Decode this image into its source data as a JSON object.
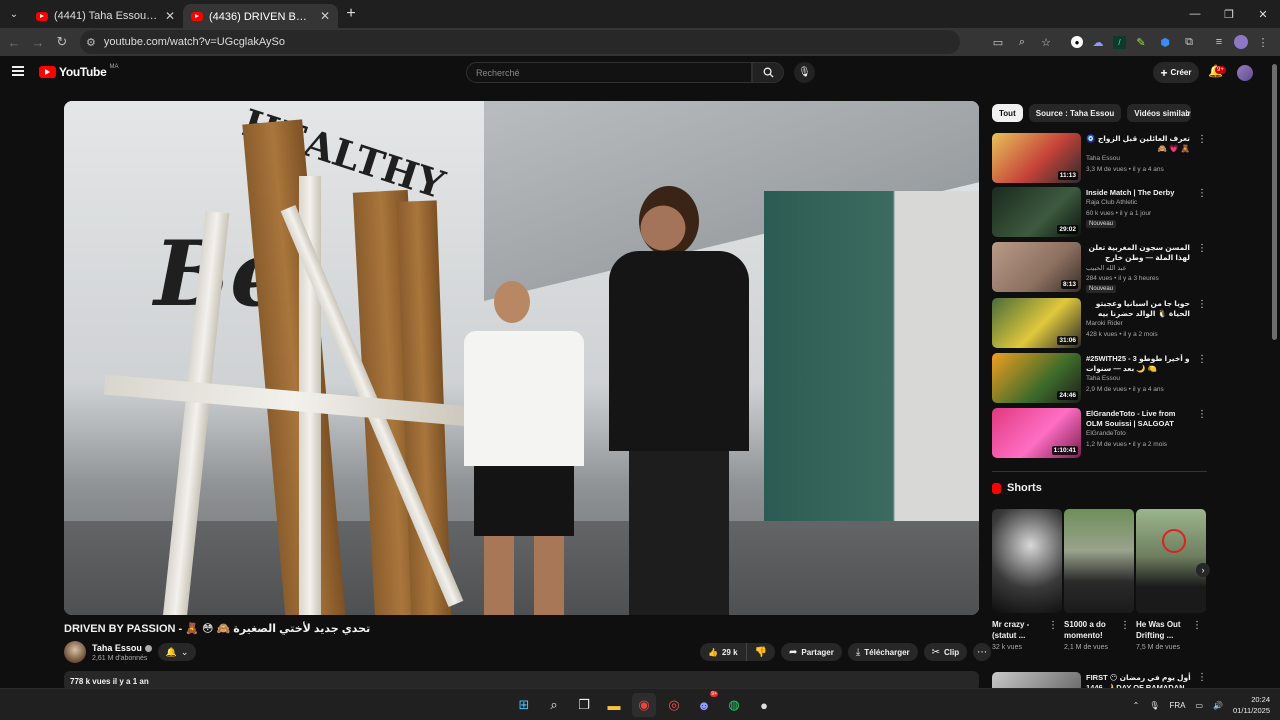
{
  "browser": {
    "tabs": [
      {
        "title": "(4441) Taha Essou - YouTube",
        "active": false
      },
      {
        "title": "(4436) DRIVEN BY PASSION - 🧸",
        "active": true
      }
    ],
    "url": "youtube.com/watch?v=UGcglakAySo"
  },
  "header": {
    "logo_text": "YouTube",
    "logo_country": "MA",
    "search_placeholder": "Recherché",
    "create_label": "Créer",
    "notif_count": "9+"
  },
  "video": {
    "title": "DRIVEN BY PASSION - 🧸 😳 🙈 تحدي جديد لأختي الصغيرة",
    "channel": "Taha Essou",
    "subscribers": "2,61 M d'abonnés",
    "likes": "29 k",
    "share_label": "Partager",
    "download_label": "Télécharger",
    "clip_label": "Clip",
    "views_date": "778 k vues  il y a 1 an",
    "overlay_word": "HEALTHY"
  },
  "chips": [
    "Tout",
    "Source : Taha Essou",
    "Vidéos similaires"
  ],
  "recommendations": [
    {
      "title": "تعرف العائلين قبل الزواج 🧿 🧸 💗 🙈",
      "channel": "Taha Essou",
      "meta": "3,3 M de vues • il y a 4 ans",
      "duration": "11:13",
      "badge": ""
    },
    {
      "title": "Inside Match | The Derby",
      "channel": "Raja Club Athletic",
      "meta": "60 k vues • il y a 1 jour",
      "duration": "29:02",
      "badge": "Nouveau"
    },
    {
      "title": "المسن سجون المغربية تعلن لهذا الملة — وطن خارج الوطن تاكده وتحرق يتنمى من",
      "channel": "عبد الله الحبيب",
      "meta": "284 vues • il y a 3 heures",
      "duration": "8:13",
      "badge": "Nouveau"
    },
    {
      "title": "حويا جا من اسبانيا وعجبتو الحياة 🐧 الوالد حضرنا بيه نويرة تدخل ليا 😄",
      "channel": "Maroki Rider",
      "meta": "428 k vues • il y a 2 mois",
      "duration": "31:06",
      "badge": ""
    },
    {
      "title": "#25WITH25 - 3 و أخيرا طوطو بعد — سنوات 🌙 🍋",
      "channel": "Taha Essou",
      "meta": "2,9 M de vues • il y a 4 ans",
      "duration": "24:46",
      "badge": ""
    },
    {
      "title": "ElGrandeToto - Live from OLM Souissi | SALGOAT Tour | ...",
      "channel": "ElGrandeToto",
      "meta": "1,2 M de vues • il y a 2 mois",
      "duration": "1:10:41",
      "badge": ""
    }
  ],
  "shorts": {
    "heading": "Shorts",
    "items": [
      {
        "title": "Mr crazy - (statut ...",
        "views": "32 k vues"
      },
      {
        "title": "S1000 a do momento!",
        "views": "2,1 M de vues"
      },
      {
        "title": "He Was Out Drifting ...",
        "views": "7,5 M de vues"
      }
    ]
  },
  "next_partial": {
    "title": "FIRST 😶 أول يوم في رمضان 1446 🌙 DAY OF RAMADAN"
  },
  "taskbar": {
    "lang": "FRA",
    "time": "20:24",
    "date": "01/11/2025",
    "discord_badge": "9+"
  }
}
